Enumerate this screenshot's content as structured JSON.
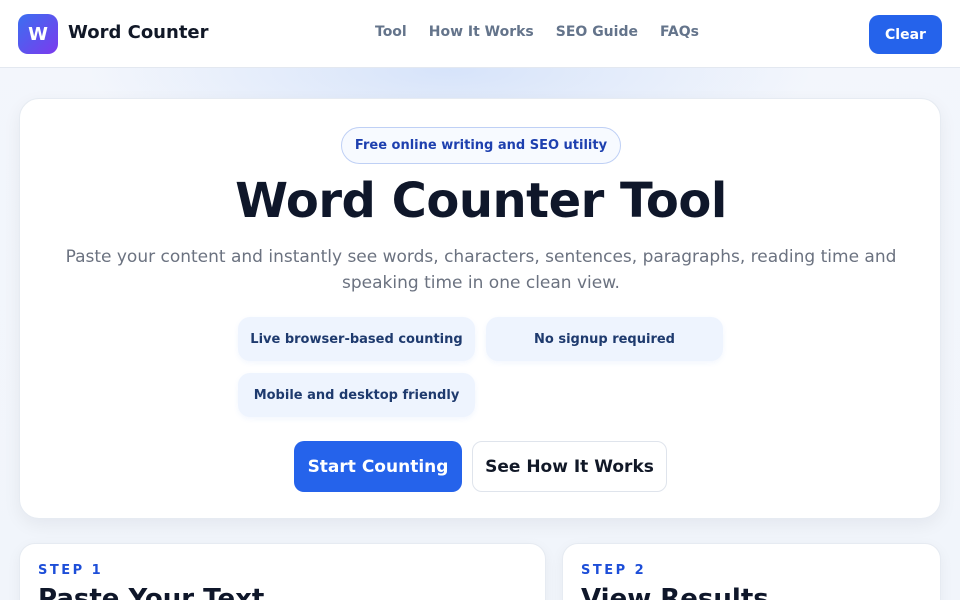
{
  "header": {
    "logo_letter": "W",
    "brand": "Word Counter",
    "nav": [
      "Tool",
      "How It Works",
      "SEO Guide",
      "FAQs"
    ],
    "clear_label": "Clear"
  },
  "hero": {
    "pill": "Free online writing and SEO utility",
    "title": "Word Counter Tool",
    "subtitle": "Paste your content and instantly see words, characters, sentences, paragraphs, reading time and speaking time in one clean view.",
    "features": [
      "Live browser-based counting",
      "No signup required",
      "Mobile and desktop friendly"
    ],
    "primary_cta": "Start Counting",
    "secondary_cta": "See How It Works"
  },
  "steps": [
    {
      "label": "STEP 1",
      "title": "Paste Your Text"
    },
    {
      "label": "STEP 2",
      "title": "View Results"
    }
  ],
  "colors": {
    "accent": "#2563eb",
    "logo_gradient_start": "#3b6ff0",
    "logo_gradient_end": "#7c3aed"
  }
}
